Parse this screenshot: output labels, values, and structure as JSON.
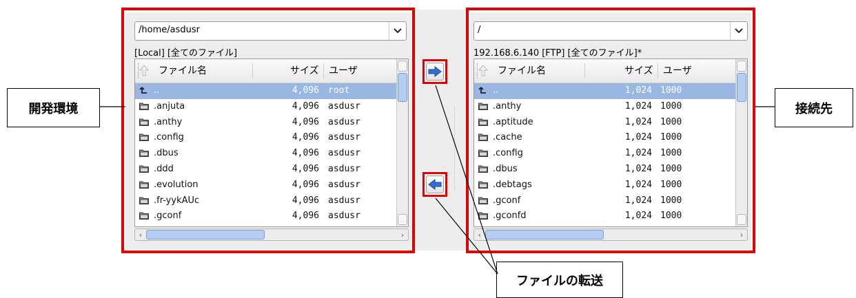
{
  "left": {
    "path": "/home/asdusr",
    "info": "[Local] [全てのファイル]",
    "columns": {
      "name": "ファイル名",
      "size": "サイズ",
      "user": "ユーザ"
    },
    "rows": [
      {
        "name": "..",
        "size": "4,096",
        "user": "root",
        "up": true
      },
      {
        "name": ".anjuta",
        "size": "4,096",
        "user": "asdusr"
      },
      {
        "name": ".anthy",
        "size": "4,096",
        "user": "asdusr"
      },
      {
        "name": ".config",
        "size": "4,096",
        "user": "asdusr"
      },
      {
        "name": ".dbus",
        "size": "4,096",
        "user": "asdusr"
      },
      {
        "name": ".ddd",
        "size": "4,096",
        "user": "asdusr"
      },
      {
        "name": ".evolution",
        "size": "4,096",
        "user": "asdusr"
      },
      {
        "name": ".fr-yykAUc",
        "size": "4,096",
        "user": "asdusr"
      },
      {
        "name": ".gconf",
        "size": "4,096",
        "user": "asdusr"
      }
    ]
  },
  "right": {
    "path": "/",
    "info": "192.168.6.140 [FTP] [全てのファイル]*",
    "columns": {
      "name": "ファイル名",
      "size": "サイズ",
      "user": "ユーザ"
    },
    "rows": [
      {
        "name": "..",
        "size": "1,024",
        "user": "1000",
        "up": true
      },
      {
        "name": ".anthy",
        "size": "1,024",
        "user": "1000"
      },
      {
        "name": ".aptitude",
        "size": "1,024",
        "user": "1000"
      },
      {
        "name": ".cache",
        "size": "1,024",
        "user": "1000"
      },
      {
        "name": ".config",
        "size": "1,024",
        "user": "1000"
      },
      {
        "name": ".dbus",
        "size": "1,024",
        "user": "1000"
      },
      {
        "name": ".debtags",
        "size": "1,024",
        "user": "1000"
      },
      {
        "name": ".gconf",
        "size": "1,024",
        "user": "1000"
      },
      {
        "name": ".gconfd",
        "size": "1,024",
        "user": "1000"
      }
    ]
  },
  "annotations": {
    "left_label": "開発環境",
    "right_label": "接続先",
    "transfer_label": "ファイルの転送"
  },
  "colors": {
    "highlight": "#e60000",
    "selection": "#9ab6e2"
  },
  "icons": {
    "upload": "arrow-right-icon",
    "download": "arrow-left-icon",
    "folder": "folder-icon",
    "parent": "parent-dir-icon",
    "combo": "chevron-down-icon",
    "sort": "sort-icon"
  }
}
